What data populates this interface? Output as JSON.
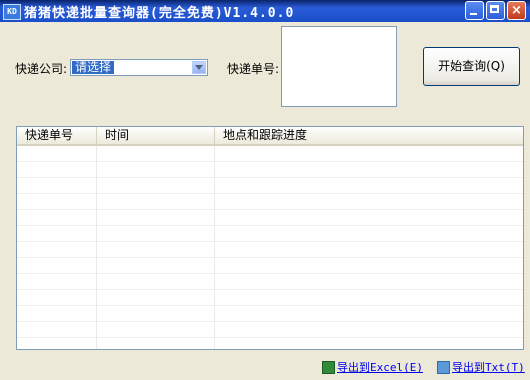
{
  "window": {
    "title": "猪猪快递批量查询器(完全免费)V1.4.0.0",
    "app_icon_text": "KD"
  },
  "form": {
    "company_label": "快递公司:",
    "company_select_value": "请选择",
    "order_label": "快递单号:",
    "query_button_label": "开始查询(Q)"
  },
  "table": {
    "columns": [
      "快递单号",
      "时间",
      "地点和跟踪进度"
    ],
    "rows": []
  },
  "footer": {
    "export_excel_label": "导出到Excel(E)",
    "export_txt_label": "导出到Txt(T)"
  },
  "icons": {
    "app": "app-icon",
    "minimize": "minimize-icon",
    "maximize": "maximize-icon",
    "close": "close-icon",
    "dropdown": "chevron-down-icon",
    "excel": "excel-icon",
    "txt": "txt-icon"
  },
  "colors": {
    "titlebar": "#2a5bd7",
    "window_bg": "#ece9d8",
    "link": "#0000ee",
    "selection": "#316ac5"
  }
}
